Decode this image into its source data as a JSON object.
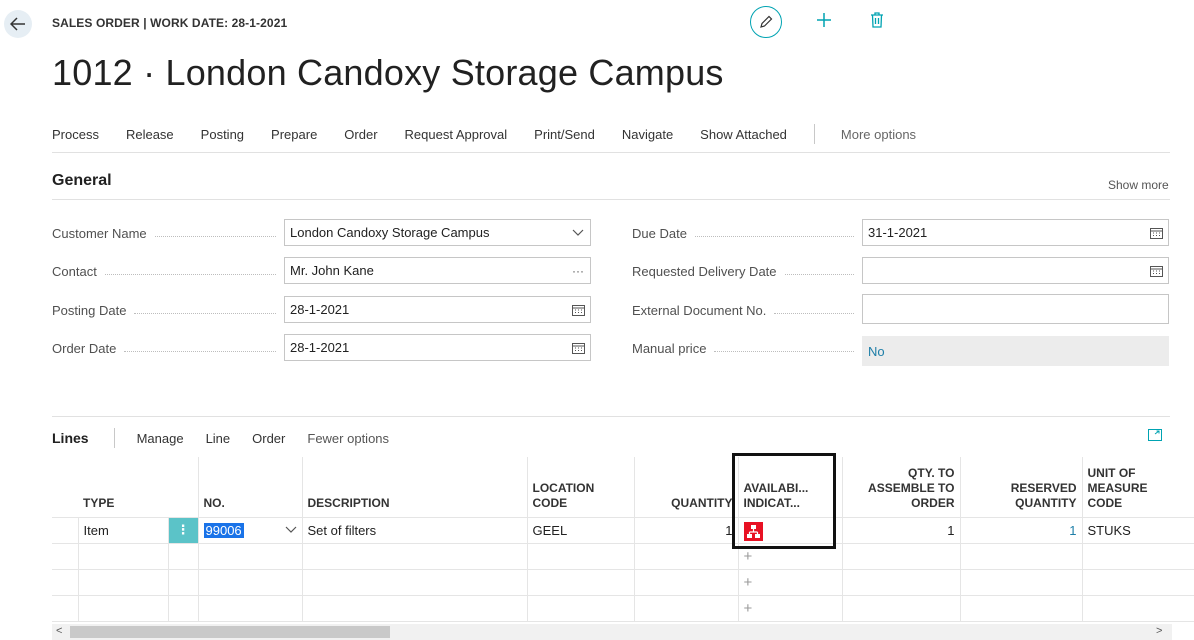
{
  "header": {
    "caption": "SALES ORDER | WORK DATE: 28-1-2021",
    "title": "1012 · London Candoxy Storage Campus",
    "icons": [
      "back-arrow-icon",
      "edit-icon",
      "plus-icon",
      "delete-icon"
    ]
  },
  "actions": {
    "items": [
      "Process",
      "Release",
      "Posting",
      "Prepare",
      "Order",
      "Request Approval",
      "Print/Send",
      "Navigate",
      "Show Attached"
    ],
    "more": "More options"
  },
  "general": {
    "title": "General",
    "show_more": "Show more",
    "left": [
      {
        "label": "Customer Name",
        "value": "London Candoxy Storage Campus",
        "icon": "chevron-down-icon"
      },
      {
        "label": "Contact",
        "value": "Mr. John Kane",
        "icon": "ellipsis-icon"
      },
      {
        "label": "Posting Date",
        "value": "28-1-2021",
        "icon": "calendar-icon"
      },
      {
        "label": "Order Date",
        "value": "28-1-2021",
        "icon": "calendar-icon"
      }
    ],
    "right": [
      {
        "label": "Due Date",
        "value": "31-1-2021",
        "icon": "calendar-icon"
      },
      {
        "label": "Requested Delivery Date",
        "value": "",
        "icon": "calendar-icon"
      },
      {
        "label": "External Document No.",
        "value": "",
        "icon": ""
      },
      {
        "label": "Manual price",
        "value": "No",
        "icon": ""
      }
    ]
  },
  "lines": {
    "title": "Lines",
    "menu": [
      "Manage",
      "Line",
      "Order"
    ],
    "fewer": "Fewer options",
    "columns": {
      "type": "TYPE",
      "no": "NO.",
      "description": "DESCRIPTION",
      "location_1": "LOCATION",
      "location_2": "CODE",
      "quantity": "QUANTITY",
      "avail_1": "AVAILABI...",
      "avail_2": "INDICAT...",
      "qta_1": "QTY. TO",
      "qta_2": "ASSEMBLE TO",
      "qta_3": "ORDER",
      "reserved_1": "RESERVED",
      "reserved_2": "QUANTITY",
      "uom_1": "UNIT OF",
      "uom_2": "MEASURE",
      "uom_3": "CODE"
    },
    "row": {
      "type": "Item",
      "no": "99006",
      "description": "Set of filters",
      "location": "GEEL",
      "quantity": "1",
      "availability_icon": "availability-red-icon",
      "qty_assemble": "1",
      "reserved": "1",
      "uom": "STUKS"
    },
    "plus": "+"
  }
}
